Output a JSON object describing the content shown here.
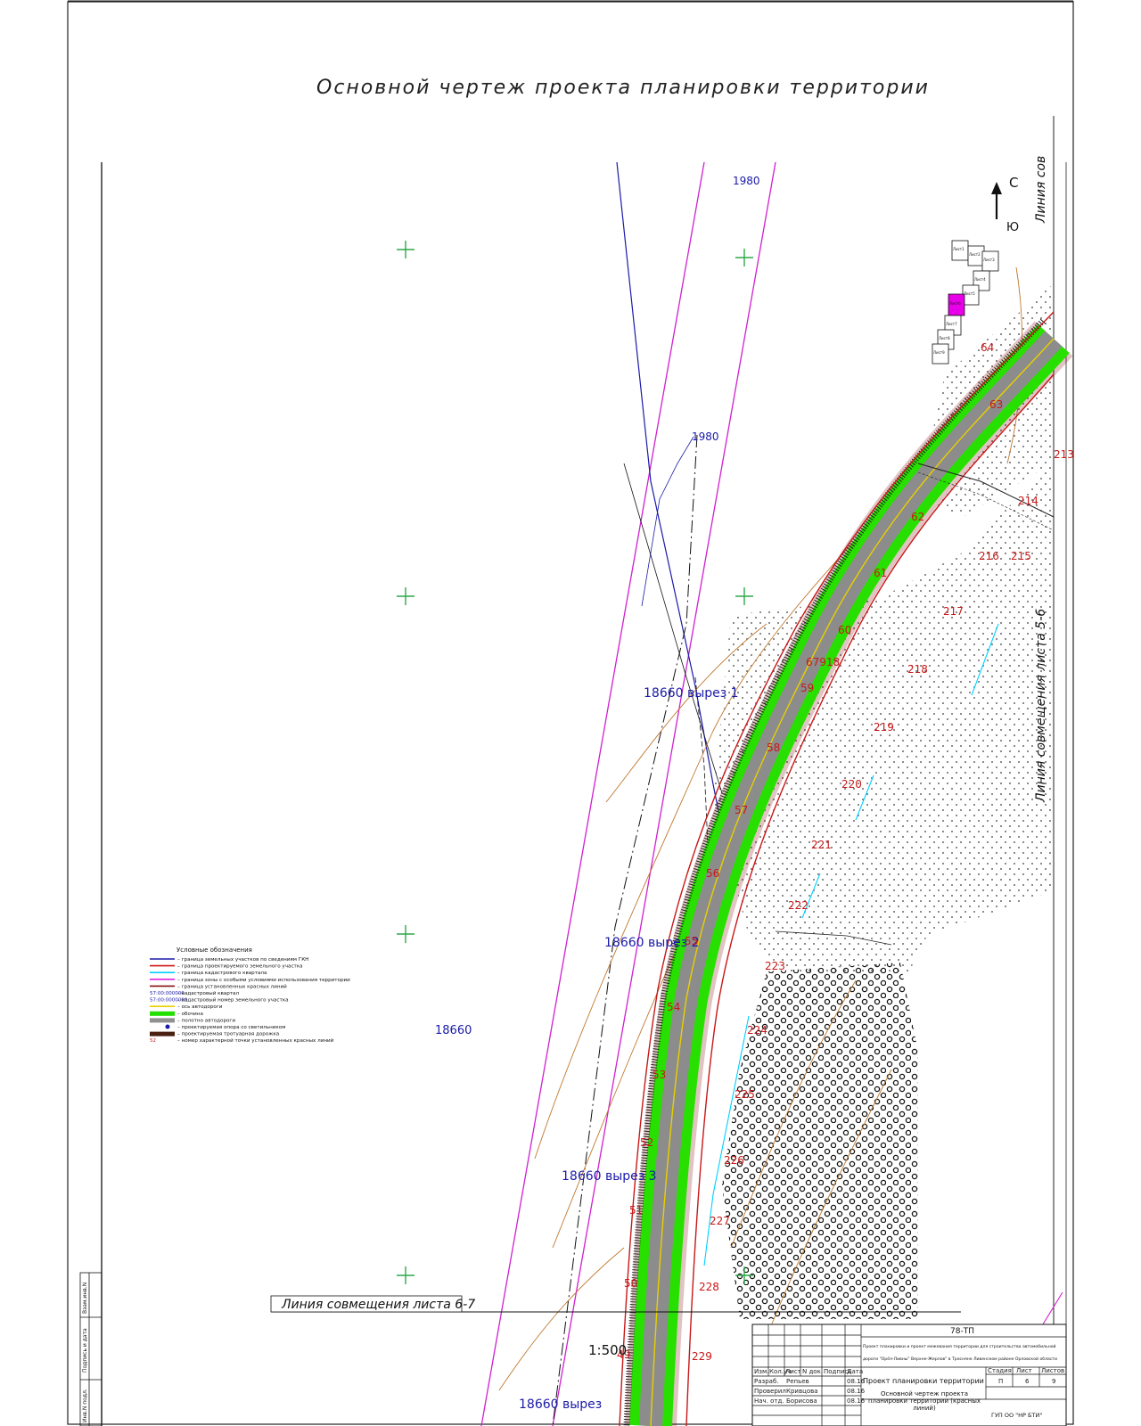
{
  "title": "Основной чертеж проекта планировки территории",
  "north": {
    "north_label": "С",
    "south_label": "Ю"
  },
  "match_lines": {
    "right": "Линия совмещения листа 5-6",
    "right_top": "Линия сов",
    "bottom": "Линия совмещения листа 6-7"
  },
  "scale": "1:500",
  "parcels": {
    "p1980_top": "1980",
    "p1980_mid": "1980",
    "cut1": "18660 вырез 1",
    "cut2": "18660 вырез 2",
    "cut3": "18660 вырез 3",
    "cut4": "18660 вырез",
    "p18660": "18660",
    "p67918": "67918"
  },
  "red_line_points_left": [
    "64",
    "63",
    "62",
    "61",
    "60",
    "59",
    "58",
    "57",
    "56",
    "55",
    "54",
    "53",
    "52",
    "51",
    "50",
    "49"
  ],
  "red_line_points_right": [
    "213",
    "214",
    "215",
    "216",
    "217",
    "218",
    "219",
    "220",
    "221",
    "222",
    "223",
    "224",
    "225",
    "226",
    "227",
    "228",
    "229"
  ],
  "legend": {
    "heading": "Условные обозначения",
    "items": [
      {
        "label": "– граница земельных участков по сведениям ГКН",
        "color": "#1a1aa8",
        "kind": "line"
      },
      {
        "label": "– граница проектируемого земельного участка",
        "color": "#d01818",
        "kind": "line"
      },
      {
        "label": "– граница кадастрового квартала",
        "color": "#00d0ff",
        "kind": "line"
      },
      {
        "label": "– граница зоны с особыми условиями использования территории",
        "color": "#e020e0",
        "kind": "line"
      },
      {
        "label": "– граница установленных красных линий",
        "color": "#8a1010",
        "kind": "line"
      },
      {
        "label": "– кадастровый квартал",
        "code": "57:00:000000",
        "color": "#1a1aa8",
        "kind": "code"
      },
      {
        "label": "– кадастровый номер земельного участка",
        "code": "57:00:0000000",
        "color": "#1a1aa8",
        "kind": "code"
      },
      {
        "label": "– ось автодороги",
        "color": "#e8d000",
        "kind": "line"
      },
      {
        "label": "– обочина",
        "color": "#22e000",
        "kind": "band"
      },
      {
        "label": "– полотно автодороги",
        "color": "#909090",
        "kind": "band"
      },
      {
        "label": "– проектируемая опора со светильником",
        "color": "#1a1aa8",
        "kind": "symbol"
      },
      {
        "label": "– проектируемая тротуарная дорожка",
        "color": "#4a2010",
        "kind": "band"
      },
      {
        "label": "– номер характерной точки установленных красных линий",
        "code": "52",
        "color": "#d01818",
        "kind": "code"
      }
    ]
  },
  "key_sheets": [
    "Лист1",
    "Лист2",
    "Лист3",
    "Лист4",
    "Лист5",
    "Лист6",
    "Лист7",
    "Лист8",
    "Лист9"
  ],
  "margin_stamps": [
    "Взам.инв.N",
    "Подпись и дата",
    "Инв.N подл."
  ],
  "title_block": {
    "code": "78-ТП",
    "project": "Проект планировки и проект межевания территории для строительства автомобильной",
    "project2": "дороги \"Орёл-Ливны\" Верхне-Жерлов\" в Тросняне Ливенском районе Орловской области",
    "roles": [
      {
        "role": "Разраб.",
        "name": "Репьев",
        "date": "08.16"
      },
      {
        "role": "Проверил",
        "name": "Кривцова",
        "date": "08.16"
      },
      {
        "role": "Нач. отд.",
        "name": "Борисова",
        "date": "08.16"
      }
    ],
    "head_cols": [
      "Изм.",
      "Кол.уч",
      "Лист",
      "N док.",
      "Подпись",
      "Дата"
    ],
    "stage_header": [
      "Стадия",
      "Лист",
      "Листов"
    ],
    "stage_values": [
      "П",
      "6",
      "9"
    ],
    "name": "Проект планировки территории",
    "drawing_name": "Основной чертеж проекта планировки территории (красных линий)",
    "org": "ГУП ОО \"НР БТИ\""
  },
  "colors": {
    "road_surface": "#8c8c8c",
    "shoulder": "#28e000",
    "axis": "#e8d000",
    "red_line": "#c81818",
    "parcel_blue": "#1a1aa8",
    "zone_magenta": "#d020d0",
    "cadastral_cyan": "#00d0ff",
    "contour_brown": "#c07830"
  }
}
